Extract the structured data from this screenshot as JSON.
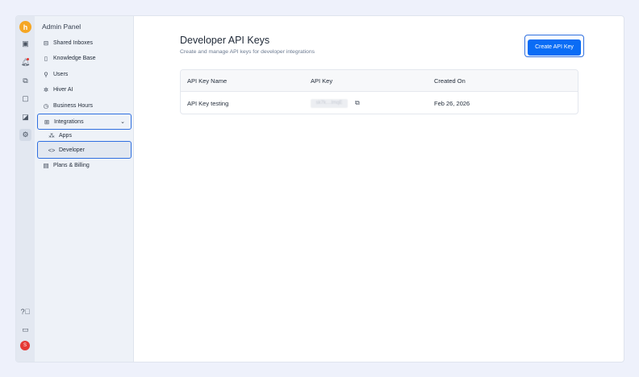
{
  "sidebar": {
    "title": "Admin Panel",
    "items": [
      {
        "label": "Shared Inboxes",
        "icon": "inbox-icon"
      },
      {
        "label": "Knowledge Base",
        "icon": "book-icon"
      },
      {
        "label": "Users",
        "icon": "user-icon"
      },
      {
        "label": "Hiver AI",
        "icon": "sparkle-icon"
      },
      {
        "label": "Business Hours",
        "icon": "clock-icon"
      },
      {
        "label": "Integrations",
        "icon": "grid-icon"
      },
      {
        "label": "Apps",
        "icon": "apps-icon"
      },
      {
        "label": "Developer",
        "icon": "code-icon"
      },
      {
        "label": "Plans & Billing",
        "icon": "billing-icon"
      }
    ]
  },
  "rail": {
    "avatar": "S"
  },
  "main": {
    "title": "Developer API Keys",
    "subtitle": "Create and manage API keys for developer integrations",
    "create_button": "Create API Key",
    "table": {
      "headers": [
        "API Key Name",
        "API Key",
        "Created On"
      ],
      "rows": [
        {
          "name": "API Key testing",
          "key": "sk7k....lmqE",
          "created": "Feb 26, 2026"
        }
      ]
    }
  },
  "colors": {
    "accent": "#0a6cf5",
    "logo": "#f5a623",
    "avatar": "#e53935"
  }
}
